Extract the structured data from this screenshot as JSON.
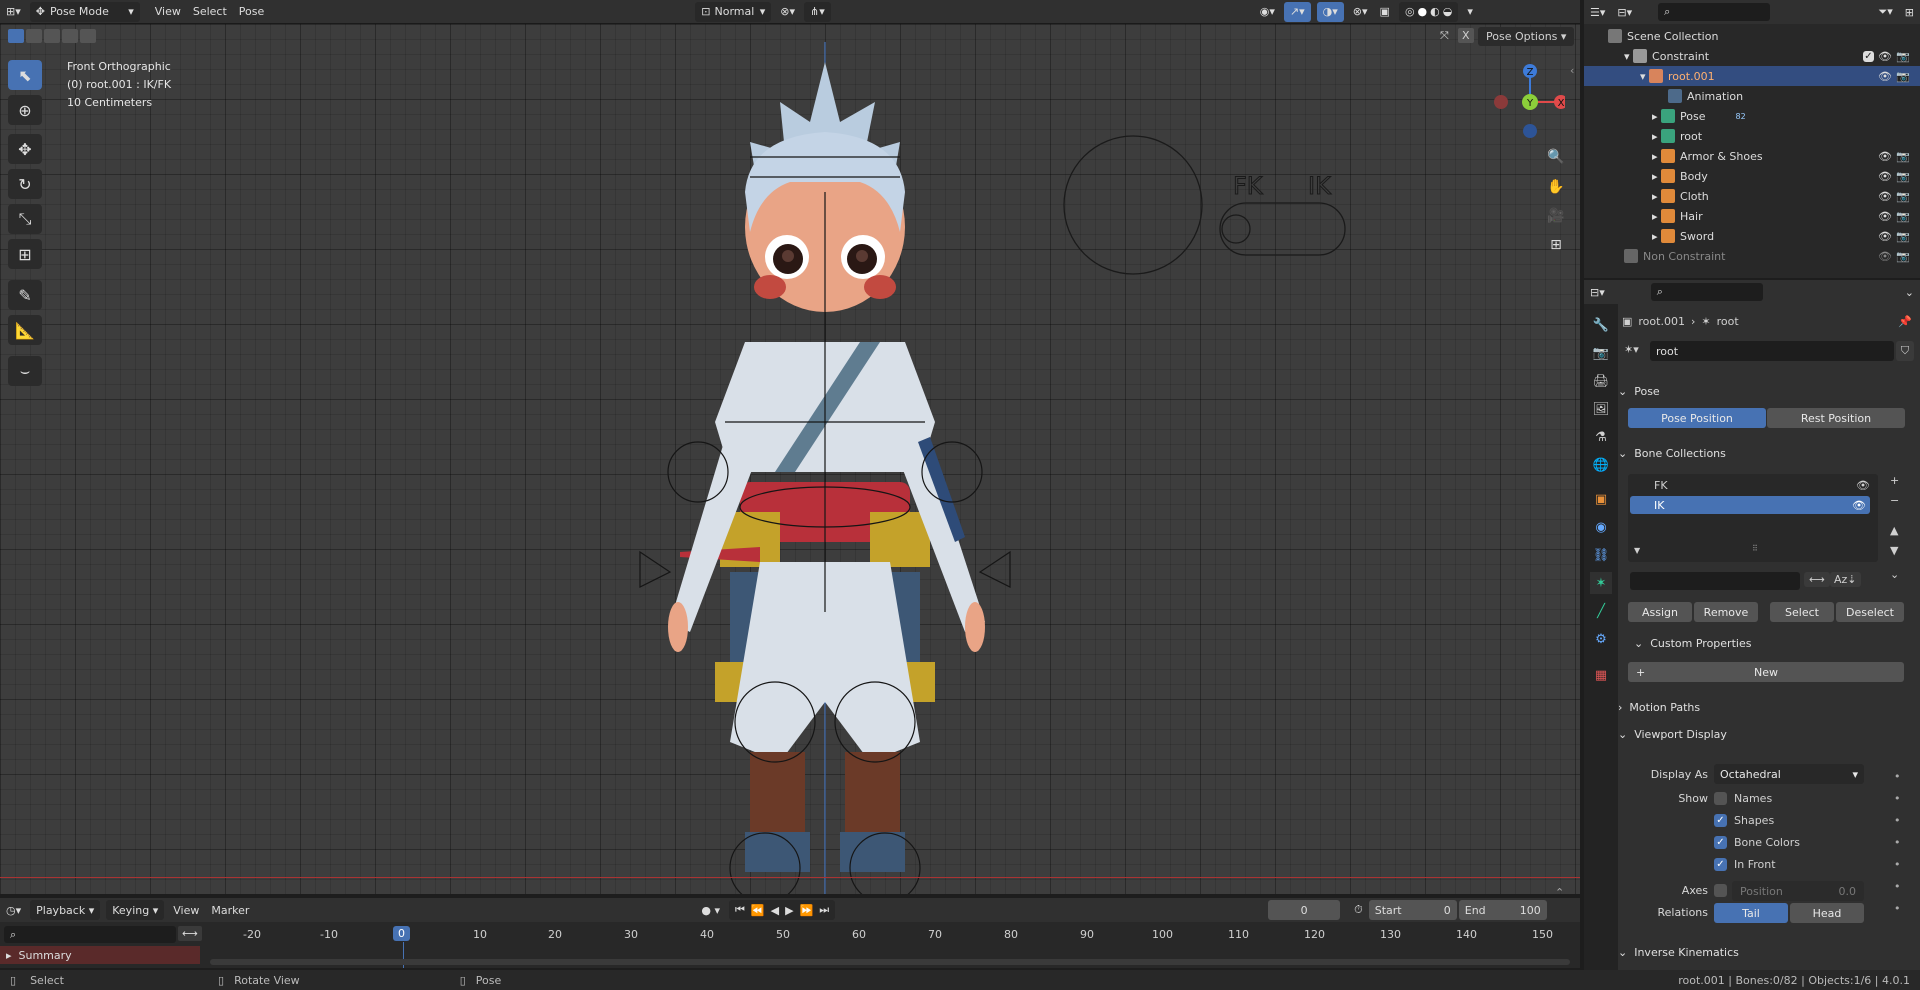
{
  "header": {
    "mode": "Pose Mode",
    "menus": [
      "View",
      "Select",
      "Pose"
    ],
    "orientation": "Normal",
    "pose_options": "Pose Options"
  },
  "viewport": {
    "view_name": "Front Orthographic",
    "object_info": "(0) root.001 : IK/FK",
    "scale": "10 Centimeters",
    "fk_label": "FK",
    "ik_label": "IK",
    "gizmo_z": "Z",
    "gizmo_y": "Y",
    "gizmo_x": "X"
  },
  "outliner": {
    "rows": [
      {
        "label": "Scene Collection",
        "indent": 0
      },
      {
        "label": "Constraint",
        "indent": 1
      },
      {
        "label": "root.001",
        "indent": 2
      },
      {
        "label": "Animation",
        "indent": 3
      },
      {
        "label": "Pose",
        "indent": 3,
        "badge": "82"
      },
      {
        "label": "root",
        "indent": 3
      },
      {
        "label": "Armor & Shoes",
        "indent": 3
      },
      {
        "label": "Body",
        "indent": 3
      },
      {
        "label": "Cloth",
        "indent": 3
      },
      {
        "label": "Hair",
        "indent": 3
      },
      {
        "label": "Sword",
        "indent": 3
      },
      {
        "label": "Non Constraint",
        "indent": 1
      }
    ]
  },
  "properties": {
    "breadcrumb_object": "root.001",
    "breadcrumb_data": "root",
    "data_name": "root",
    "pose_section": "Pose",
    "pose_position": "Pose Position",
    "rest_position": "Rest Position",
    "bone_collections_section": "Bone Collections",
    "collections": [
      "FK",
      "IK"
    ],
    "assign": "Assign",
    "remove": "Remove",
    "select": "Select",
    "deselect": "Deselect",
    "custom_properties": "Custom Properties",
    "new": "New",
    "motion_paths": "Motion Paths",
    "viewport_display": "Viewport Display",
    "display_as_label": "Display As",
    "display_as_value": "Octahedral",
    "show_label": "Show",
    "names": "Names",
    "shapes": "Shapes",
    "bone_colors": "Bone Colors",
    "in_front": "In Front",
    "axes_label": "Axes",
    "position_label": "Position",
    "position_value": "0.0",
    "relations_label": "Relations",
    "tail": "Tail",
    "head": "Head",
    "inverse_kinematics": "Inverse Kinematics"
  },
  "timeline": {
    "menus": [
      "Playback",
      "Keying",
      "View",
      "Marker"
    ],
    "current_frame": "0",
    "start_label": "Start",
    "start_value": "0",
    "end_label": "End",
    "end_value": "100",
    "ruler": [
      "-20",
      "-10",
      "0",
      "10",
      "20",
      "30",
      "40",
      "50",
      "60",
      "70",
      "80",
      "90",
      "100",
      "110",
      "120",
      "130",
      "140",
      "150"
    ],
    "summary": "Summary"
  },
  "status": {
    "select": "Select",
    "rotate": "Rotate View",
    "pose": "Pose",
    "info": "root.001 | Bones:0/82 | Objects:1/6 | 4.0.1"
  }
}
